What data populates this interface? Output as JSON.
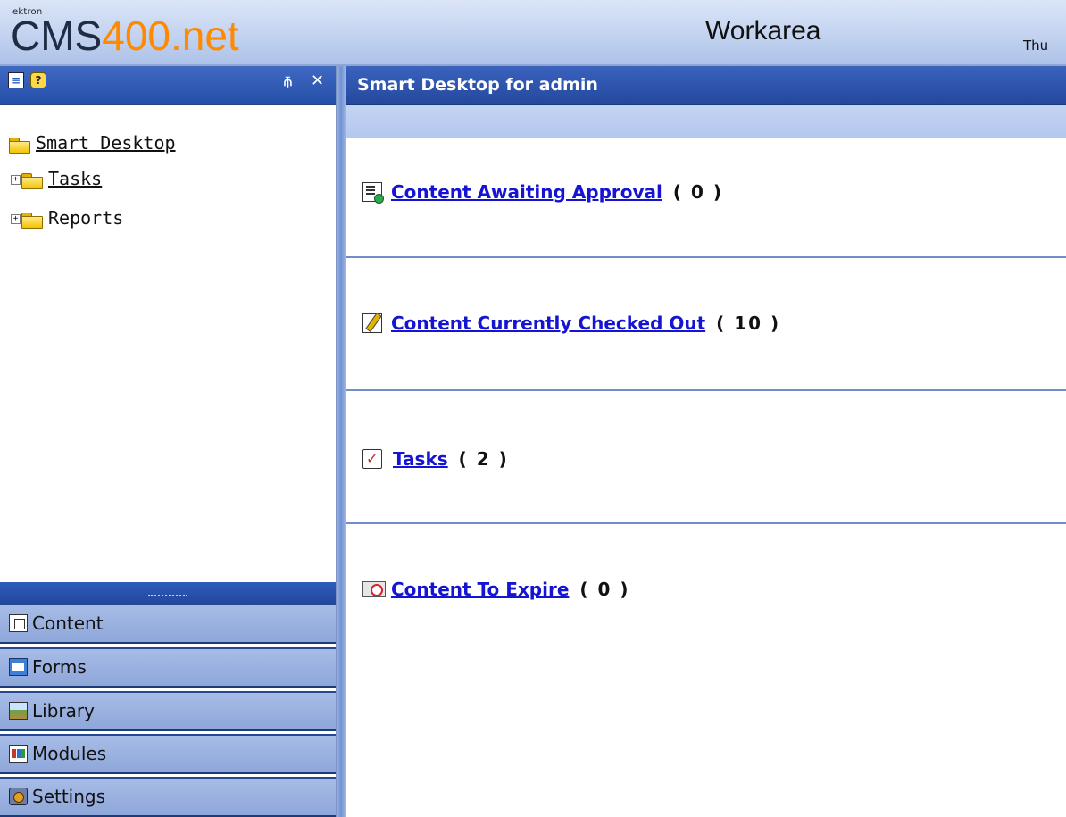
{
  "header": {
    "brand_small": "ektron",
    "brand_cms": "CMS",
    "brand_400": "400",
    "brand_net": ".net",
    "title": "Workarea",
    "date_partial": "Thu"
  },
  "left_panel": {
    "toolbar_icons": [
      "toc-icon",
      "help-icon",
      "pin-icon",
      "close-icon"
    ],
    "tree": [
      {
        "label": "Smart Desktop",
        "icon": "folder-open-icon",
        "expandable": false
      },
      {
        "label": "Tasks",
        "icon": "folder-icon",
        "expandable": true
      },
      {
        "label": "Reports",
        "icon": "folder-icon",
        "expandable": true
      }
    ],
    "nav_bars": [
      {
        "label": "Content",
        "icon": "content-icon"
      },
      {
        "label": "Forms",
        "icon": "forms-icon"
      },
      {
        "label": "Library",
        "icon": "library-icon"
      },
      {
        "label": "Modules",
        "icon": "modules-icon"
      },
      {
        "label": "Settings",
        "icon": "settings-icon"
      }
    ]
  },
  "main": {
    "title": "Smart Desktop for admin",
    "items": [
      {
        "label": "Content Awaiting Approval",
        "count": "( 0 )",
        "icon": "approval-icon"
      },
      {
        "label": "Content Currently Checked Out",
        "count": "( 10 )",
        "icon": "checkout-icon"
      },
      {
        "label": "Tasks",
        "count": "( 2 )",
        "icon": "tasks-icon"
      },
      {
        "label": "Content To Expire",
        "count": "( 0 )",
        "icon": "expire-icon"
      }
    ]
  },
  "colors": {
    "header_bg": "#c3d3f0",
    "titlebar_blue": "#24489e",
    "link_blue": "#1414d2",
    "brand_orange": "#ff8a00"
  }
}
